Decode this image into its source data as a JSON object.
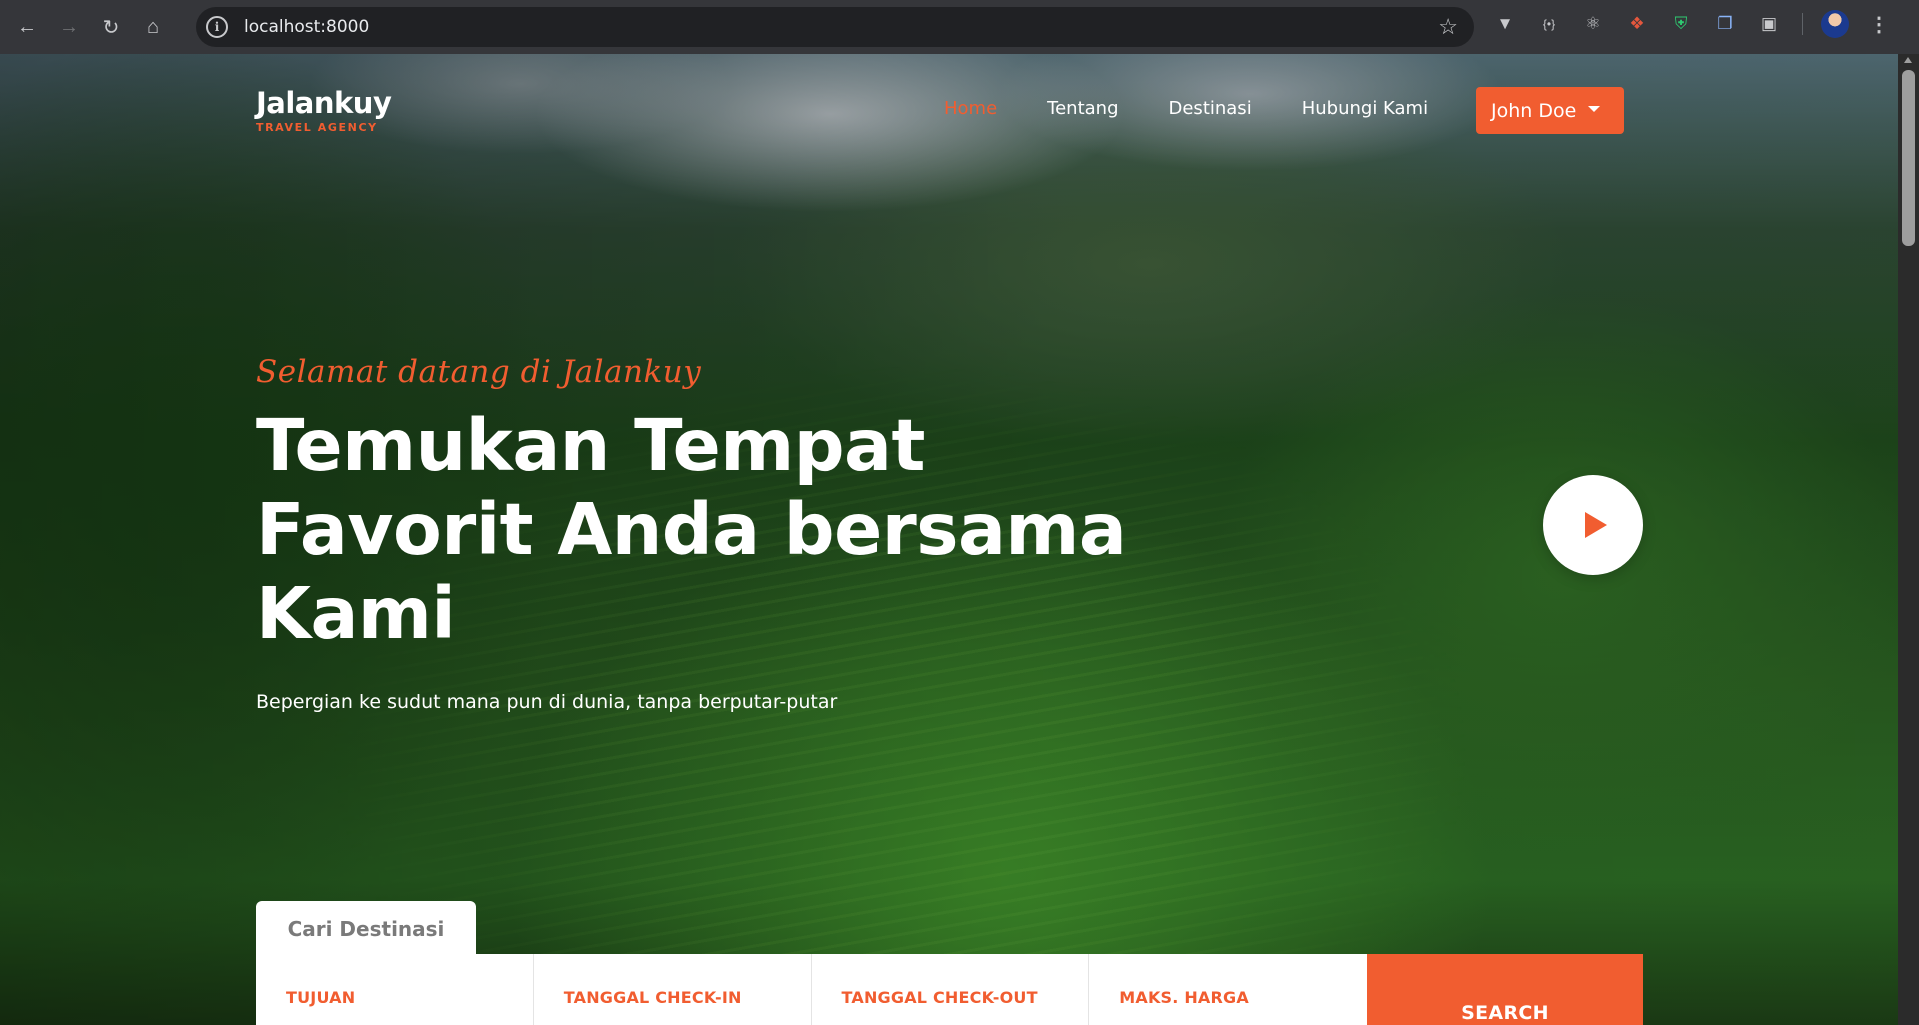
{
  "browser": {
    "url": "localhost:8000",
    "extensions": [
      "vimium-icon",
      "json-icon",
      "react-icon",
      "color-picker-icon",
      "shield-icon",
      "clipboard-icon",
      "puzzle-icon"
    ]
  },
  "site": {
    "brand": {
      "name": "Jalankuy",
      "tagline": "TRAVEL AGENCY"
    },
    "nav": [
      {
        "label": "Home",
        "active": true
      },
      {
        "label": "Tentang",
        "active": false
      },
      {
        "label": "Destinasi",
        "active": false
      },
      {
        "label": "Hubungi Kami",
        "active": false
      }
    ],
    "user_menu": {
      "label": "John Doe"
    },
    "colors": {
      "accent": "#f15d30",
      "text": "#ffffff"
    }
  },
  "hero": {
    "welcome": "Selamat datang di Jalankuy",
    "title": "Temukan Tempat Favorit Anda bersama Kami",
    "subtitle": "Bepergian ke sudut mana pun di dunia, tanpa berputar-putar"
  },
  "search": {
    "tab_label": "Cari Destinasi",
    "fields": [
      {
        "label": "TUJUAN"
      },
      {
        "label": "TANGGAL CHECK-IN"
      },
      {
        "label": "TANGGAL CHECK-OUT"
      },
      {
        "label": "MAKS. HARGA"
      }
    ],
    "button_label": "SEARCH"
  }
}
